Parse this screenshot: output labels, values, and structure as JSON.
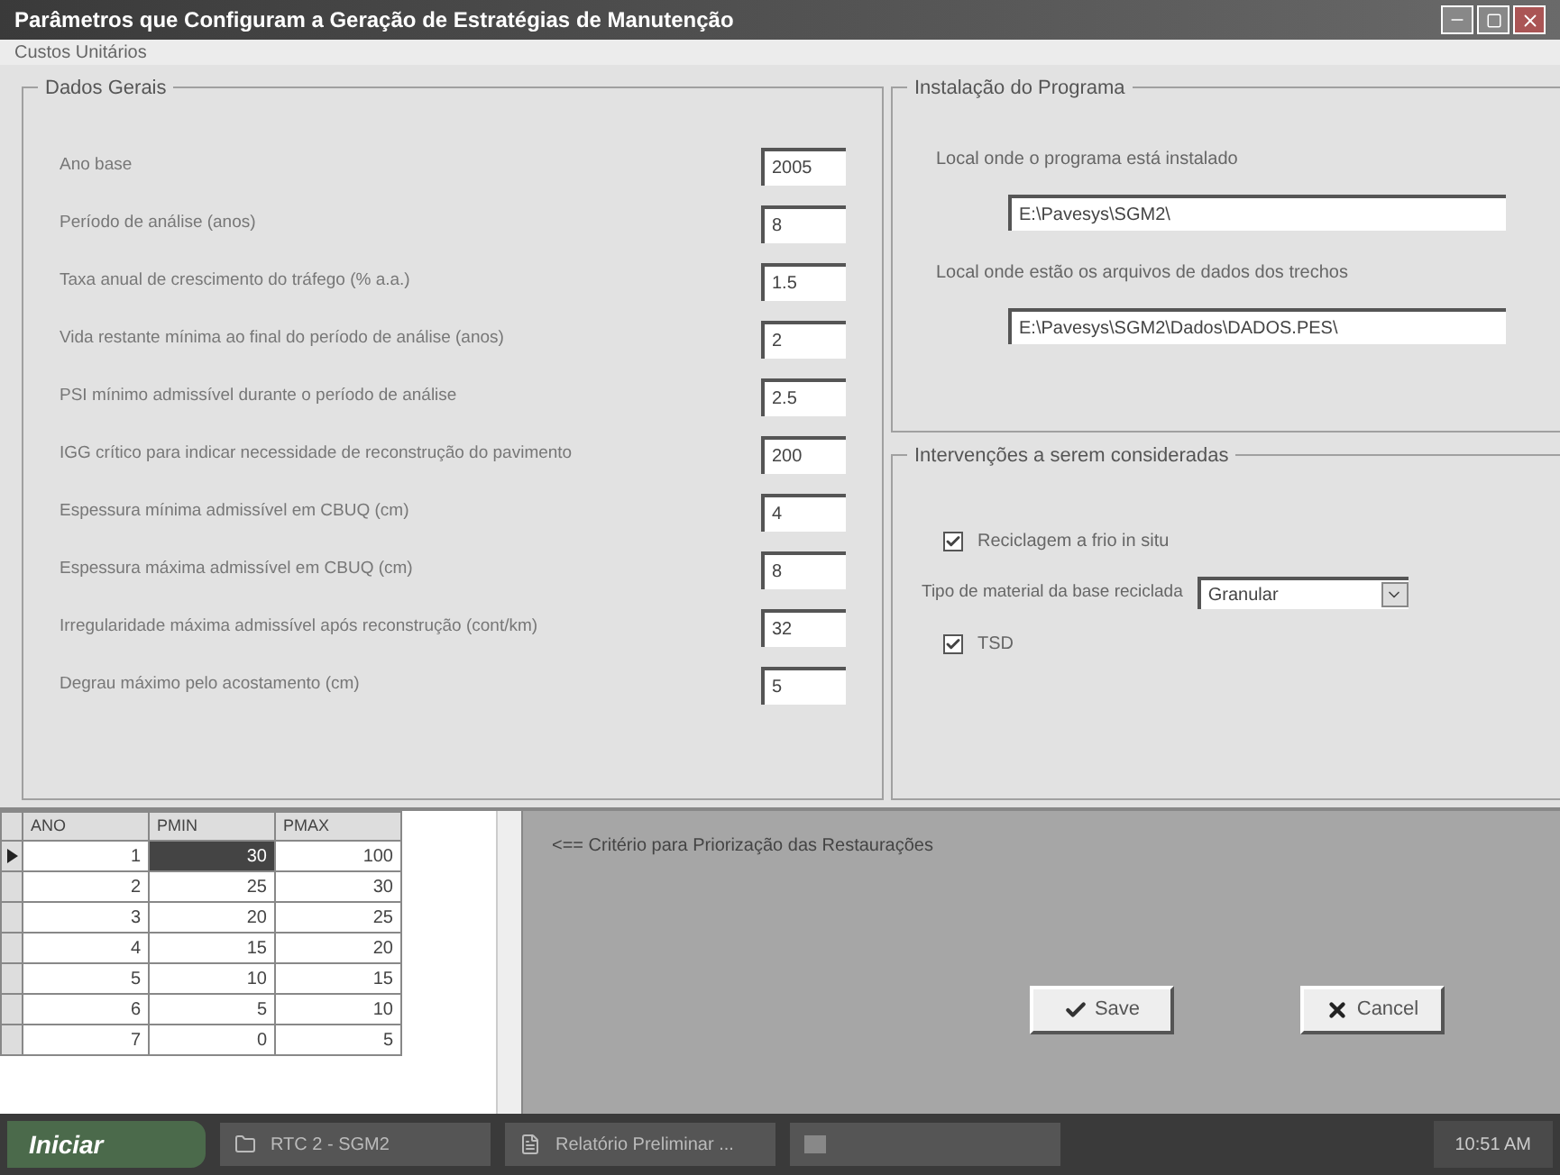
{
  "window": {
    "title": "Parâmetros que Configuram a Geração de Estratégias de Manutenção"
  },
  "menu": [
    "Custos Unitários"
  ],
  "general": {
    "title": "Dados Gerais",
    "fields": [
      {
        "label": "Ano base",
        "value": "2005"
      },
      {
        "label": "Período de análise (anos)",
        "value": "8"
      },
      {
        "label": "Taxa anual de crescimento do tráfego (% a.a.)",
        "value": "1.5"
      },
      {
        "label": "Vida restante mínima ao final do período de análise (anos)",
        "value": "2"
      },
      {
        "label": "PSI mínimo admissível durante o período de análise",
        "value": "2.5"
      },
      {
        "label": "IGG crítico para indicar necessidade de reconstrução do pavimento",
        "value": "200"
      },
      {
        "label": "Espessura mínima admissível em CBUQ (cm)",
        "value": "4"
      },
      {
        "label": "Espessura máxima admissível em CBUQ (cm)",
        "value": "8"
      },
      {
        "label": "Irregularidade máxima admissível após reconstrução (cont/km)",
        "value": "32"
      },
      {
        "label": "Degrau máximo pelo acostamento (cm)",
        "value": "5"
      }
    ]
  },
  "install": {
    "title": "Instalação do Programa",
    "fields": [
      {
        "label": "Local onde o programa está instalado",
        "value": "E:\\Pavesys\\SGM2\\"
      },
      {
        "label": "Local onde estão os arquivos de dados dos trechos",
        "value": "E:\\Pavesys\\SGM2\\Dados\\DADOS.PES\\"
      }
    ]
  },
  "interventions": {
    "title": "Intervenções a serem consideradas",
    "items": [
      {
        "kind": "checkbox",
        "label": "Reciclagem a frio in situ",
        "checked": true
      },
      {
        "kind": "select",
        "label": "Tipo de material da base reciclada",
        "value": "Granular"
      },
      {
        "kind": "checkbox",
        "label": "TSD",
        "checked": true
      }
    ]
  },
  "table": {
    "columns": [
      "ANO",
      "PMIN",
      "PMAX"
    ],
    "rows": [
      {
        "cells": [
          "1",
          "30",
          "100"
        ],
        "selected": true
      },
      {
        "cells": [
          "2",
          "25",
          "30"
        ],
        "selected": false
      },
      {
        "cells": [
          "3",
          "20",
          "25"
        ],
        "selected": false
      },
      {
        "cells": [
          "4",
          "15",
          "20"
        ],
        "selected": false
      },
      {
        "cells": [
          "5",
          "10",
          "15"
        ],
        "selected": false
      },
      {
        "cells": [
          "6",
          "5",
          "10"
        ],
        "selected": false
      },
      {
        "cells": [
          "7",
          "0",
          "5"
        ],
        "selected": false
      }
    ]
  },
  "note": "<== Critério para Priorização das Restaurações",
  "buttons": [
    {
      "kind": "save",
      "label": "Save"
    },
    {
      "kind": "cancel",
      "label": "Cancel"
    }
  ],
  "taskbar": {
    "start": "Iniciar",
    "tasks": [
      {
        "kind": "folder",
        "label": "RTC 2 - SGM2"
      },
      {
        "kind": "doc",
        "label": "Relatório Preliminar ..."
      },
      {
        "kind": "app"
      }
    ],
    "clock": "10:51 AM"
  }
}
